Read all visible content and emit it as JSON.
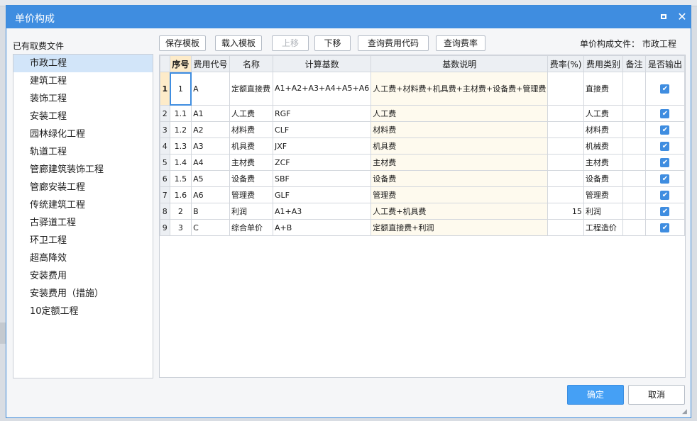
{
  "dialog": {
    "title": "单价构成"
  },
  "left": {
    "title": "已有取费文件",
    "items": [
      "市政工程",
      "建筑工程",
      "装饰工程",
      "安装工程",
      "园林绿化工程",
      "轨道工程",
      "管廊建筑装饰工程",
      "管廊安装工程",
      "传统建筑工程",
      "古驿道工程",
      "环卫工程",
      "超高降效",
      "安装费用",
      "安装费用（措施）",
      "10定额工程"
    ]
  },
  "toolbar": {
    "save_template": "保存模板",
    "load_template": "载入模板",
    "move_up": "上移",
    "move_down": "下移",
    "query_code": "查询费用代码",
    "query_rate": "查询费率",
    "file_label": "单价构成文件：  市政工程"
  },
  "grid": {
    "headers": [
      "序号",
      "费用代号",
      "名称",
      "计算基数",
      "基数说明",
      "费率(%)",
      "费用类别",
      "备注",
      "是否输出"
    ],
    "rows": [
      {
        "rn": "1",
        "seq": "1",
        "code": "A",
        "name": "定额直接费",
        "base": "A1+A2+A3+A4+A5+A6",
        "desc": "人工费+材料费+机具费+主材费+设备费+管理费",
        "rate": "",
        "cat": "直接费",
        "note": ""
      },
      {
        "rn": "2",
        "seq": "1.1",
        "code": "A1",
        "name": "人工费",
        "base": "RGF",
        "desc": "人工费",
        "rate": "",
        "cat": "人工费",
        "note": ""
      },
      {
        "rn": "3",
        "seq": "1.2",
        "code": "A2",
        "name": "材料费",
        "base": "CLF",
        "desc": "材料费",
        "rate": "",
        "cat": "材料费",
        "note": ""
      },
      {
        "rn": "4",
        "seq": "1.3",
        "code": "A3",
        "name": "机具费",
        "base": "JXF",
        "desc": "机具费",
        "rate": "",
        "cat": "机械费",
        "note": ""
      },
      {
        "rn": "5",
        "seq": "1.4",
        "code": "A4",
        "name": "主材费",
        "base": "ZCF",
        "desc": "主材费",
        "rate": "",
        "cat": "主材费",
        "note": ""
      },
      {
        "rn": "6",
        "seq": "1.5",
        "code": "A5",
        "name": "设备费",
        "base": "SBF",
        "desc": "设备费",
        "rate": "",
        "cat": "设备费",
        "note": ""
      },
      {
        "rn": "7",
        "seq": "1.6",
        "code": "A6",
        "name": "管理费",
        "base": "GLF",
        "desc": "管理费",
        "rate": "",
        "cat": "管理费",
        "note": ""
      },
      {
        "rn": "8",
        "seq": "2",
        "code": "B",
        "name": "利润",
        "base": "A1+A3",
        "desc": "人工费+机具费",
        "rate": "15",
        "cat": "利润",
        "note": ""
      },
      {
        "rn": "9",
        "seq": "3",
        "code": "C",
        "name": "综合单价",
        "base": "A+B",
        "desc": "定额直接费+利润",
        "rate": "",
        "cat": "工程造价",
        "note": ""
      }
    ]
  },
  "footer": {
    "ok": "确定",
    "cancel": "取消"
  },
  "colors": {
    "accent": "#3f8de0",
    "selected": "#d2e5f9",
    "active_header": "#fdebc9"
  }
}
